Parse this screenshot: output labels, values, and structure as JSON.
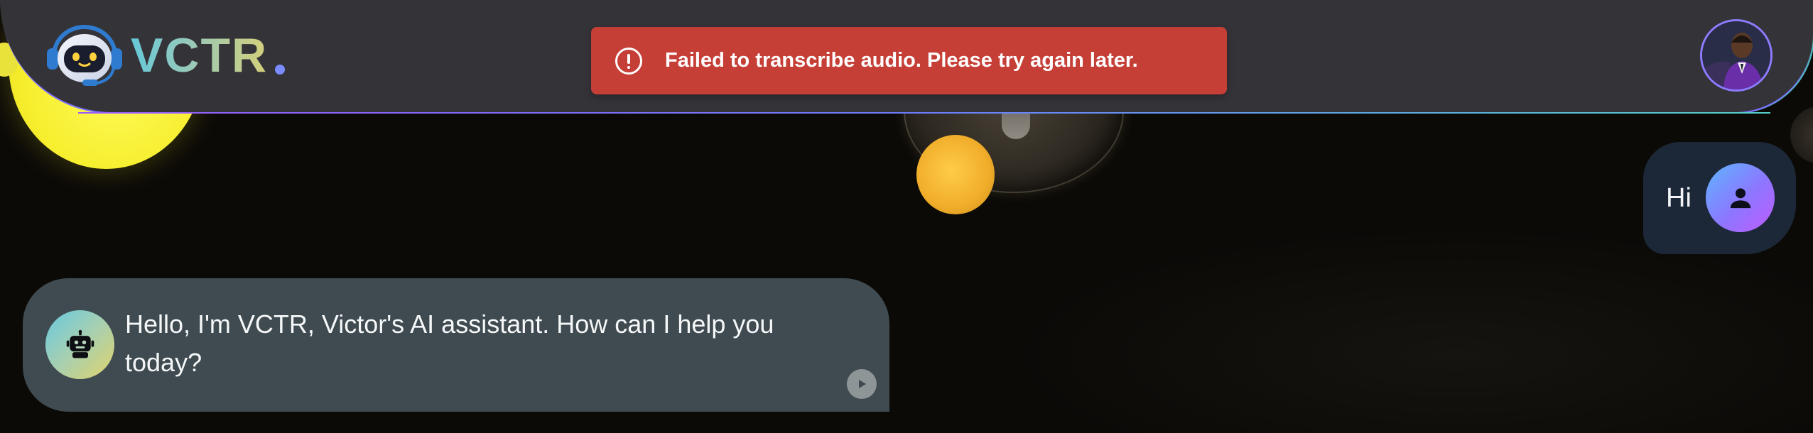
{
  "header": {
    "brand_name": "VCTR",
    "logo_icon": "robot-headset-icon",
    "user_avatar_icon": "user-photo-avatar"
  },
  "toast": {
    "icon": "alert-circle-icon",
    "message": "Failed to transcribe audio. Please try again later.",
    "color": "#c53f37"
  },
  "conversation": {
    "messages": [
      {
        "role": "user",
        "text": "Hi",
        "avatar_icon": "person-icon"
      },
      {
        "role": "assistant",
        "text": "Hello, I'm VCTR, Victor's AI assistant. How can I help you today?",
        "avatar_icon": "robot-icon",
        "action_icon": "play-icon"
      }
    ]
  },
  "colors": {
    "header_bg": "#343338",
    "user_bubble": "#1c2838",
    "assistant_bubble": "#3f4b50",
    "accent_purple": "#8d7cff",
    "accent_teal": "#66c9d8"
  }
}
